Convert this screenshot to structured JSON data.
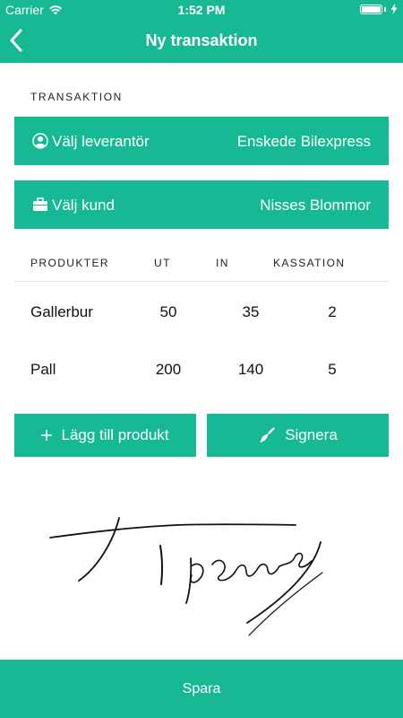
{
  "status_bar": {
    "carrier": "Carrier",
    "time": "1:52 PM",
    "icons": [
      "wifi-icon",
      "battery-icon",
      "charging-bolt-icon"
    ]
  },
  "nav": {
    "back_icon": "chevron-left-icon",
    "title": "Ny transaktion"
  },
  "transaction": {
    "section_label": "TRANSAKTION",
    "supplier": {
      "icon": "user-circle-icon",
      "label": "Välj leverantör",
      "value": "Enskede Bilexpress"
    },
    "customer": {
      "icon": "briefcase-icon",
      "label": "Välj kund",
      "value": "Nisses Blommor"
    }
  },
  "products": {
    "columns": [
      "PRODUKTER",
      "UT",
      "IN",
      "KASSATION"
    ],
    "rows": [
      {
        "name": "Gallerbur",
        "ut": "50",
        "in": "35",
        "kassation": "2"
      },
      {
        "name": "Pall",
        "ut": "200",
        "in": "140",
        "kassation": "5"
      }
    ]
  },
  "actions": {
    "add_product": {
      "icon": "plus-icon",
      "label": "Lägg till produkt"
    },
    "sign": {
      "icon": "paintbrush-icon",
      "label": "Signera"
    }
  },
  "footer": {
    "save_label": "Spara"
  },
  "colors": {
    "accent": "#17b894",
    "text": "#111111",
    "background": "#ffffff"
  }
}
